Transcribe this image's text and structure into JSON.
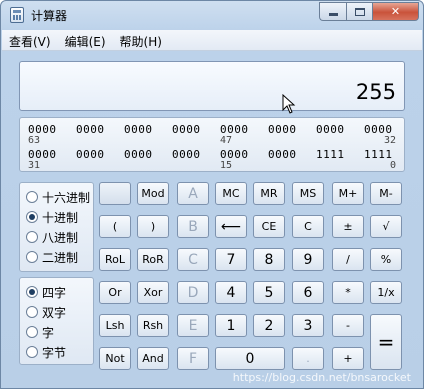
{
  "window": {
    "title": "计算器"
  },
  "menu": [
    "查看(V)",
    "编辑(E)",
    "帮助(H)"
  ],
  "display": {
    "value": "255"
  },
  "bits": {
    "row1": [
      "0000",
      "0000",
      "0000",
      "0000",
      "0000",
      "0000",
      "0000",
      "0000"
    ],
    "row1_idx": [
      "63",
      "47",
      "32"
    ],
    "row2": [
      "0000",
      "0000",
      "0000",
      "0000",
      "0000",
      "0000",
      "1111",
      "1111"
    ],
    "row2_idx": [
      "31",
      "15",
      "0"
    ]
  },
  "base_options": [
    {
      "label": "十六进制",
      "selected": false
    },
    {
      "label": "十进制",
      "selected": true
    },
    {
      "label": "八进制",
      "selected": false
    },
    {
      "label": "二进制",
      "selected": false
    }
  ],
  "word_options": [
    {
      "label": "四字",
      "selected": true
    },
    {
      "label": "双字",
      "selected": false
    },
    {
      "label": "字",
      "selected": false
    },
    {
      "label": "字节",
      "selected": false
    }
  ],
  "buttons": {
    "mod": "Mod",
    "A": "A",
    "MC": "MC",
    "MR": "MR",
    "MS": "MS",
    "Mplus": "M+",
    "Mminus": "M-",
    "lparen": "(",
    "rparen": ")",
    "B": "B",
    "back": "⟵",
    "CE": "CE",
    "C": "C",
    "pm": "±",
    "sqrt": "√",
    "RoL": "RoL",
    "RoR": "RoR",
    "Cc": "C",
    "n7": "7",
    "n8": "8",
    "n9": "9",
    "div": "/",
    "pct": "%",
    "Or": "Or",
    "Xor": "Xor",
    "D": "D",
    "n4": "4",
    "n5": "5",
    "n6": "6",
    "mul": "*",
    "recip": "1/x",
    "Lsh": "Lsh",
    "Rsh": "Rsh",
    "E": "E",
    "n1": "1",
    "n2": "2",
    "n3": "3",
    "sub": "-",
    "eq": "=",
    "Not": "Not",
    "And": "And",
    "F": "F",
    "n0": "0",
    "dot": ".",
    "add": "+"
  },
  "watermark": "https://blog.csdn.net/bnsarocket"
}
